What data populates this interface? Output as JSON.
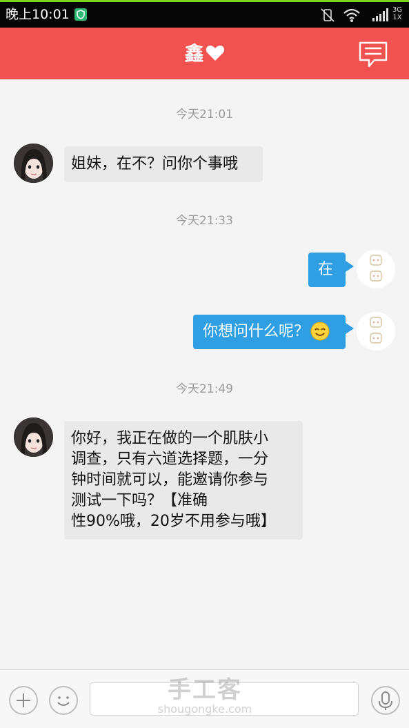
{
  "status_bar": {
    "time": "晚上10:01",
    "network_top": "3G",
    "network_bottom": "1X"
  },
  "header": {
    "title": "鑫",
    "heart_icon": "heart-icon",
    "message_icon": "message-list-icon",
    "background": "#f2524f"
  },
  "messages": [
    {
      "type": "timestamp",
      "text": "今天21:01"
    },
    {
      "type": "incoming",
      "text": "姐妹，在不？问你个事哦"
    },
    {
      "type": "timestamp",
      "text": "今天21:33"
    },
    {
      "type": "outgoing",
      "text": "在"
    },
    {
      "type": "outgoing",
      "text": "你想问什么呢？",
      "emoji": "smile-emoji"
    },
    {
      "type": "timestamp",
      "text": "今天21:49"
    },
    {
      "type": "incoming",
      "lines": [
        "你好，我正在做的一个肌肤小",
        "调查，只有六道选择题，一分",
        "钟时间就可以，能邀请你参与",
        "测试一下吗？【准确",
        "性90%哦，20岁不用参与哦】"
      ]
    }
  ],
  "input_bar": {
    "plus_icon": "plus-icon",
    "emoji_icon": "emoji-icon",
    "voice_icon": "microphone-icon"
  },
  "watermark": {
    "title": "手工客",
    "url": "shougongke.com"
  },
  "colors": {
    "accent": "#f2524f",
    "outgoing_bubble": "#2f9ee2",
    "incoming_bubble": "#e9e9e9"
  }
}
